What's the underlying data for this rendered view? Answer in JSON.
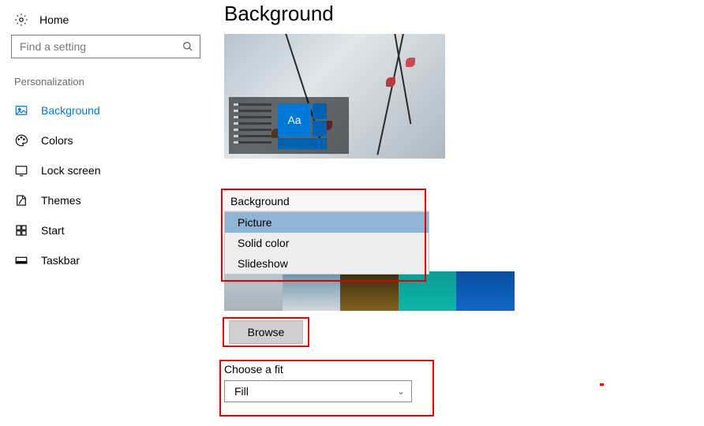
{
  "sidebar": {
    "home": "Home",
    "search_placeholder": "Find a setting",
    "section": "Personalization",
    "items": [
      {
        "label": "Background",
        "icon": "picture"
      },
      {
        "label": "Colors",
        "icon": "palette"
      },
      {
        "label": "Lock screen",
        "icon": "lock"
      },
      {
        "label": "Themes",
        "icon": "themes"
      },
      {
        "label": "Start",
        "icon": "start"
      },
      {
        "label": "Taskbar",
        "icon": "taskbar"
      }
    ]
  },
  "page": {
    "title": "Background",
    "preview_tile_text": "Aa"
  },
  "background_dropdown": {
    "label": "Background",
    "options": [
      "Picture",
      "Solid color",
      "Slideshow"
    ],
    "selected": "Picture"
  },
  "browse_button": "Browse",
  "fit": {
    "label": "Choose a fit",
    "value": "Fill"
  }
}
